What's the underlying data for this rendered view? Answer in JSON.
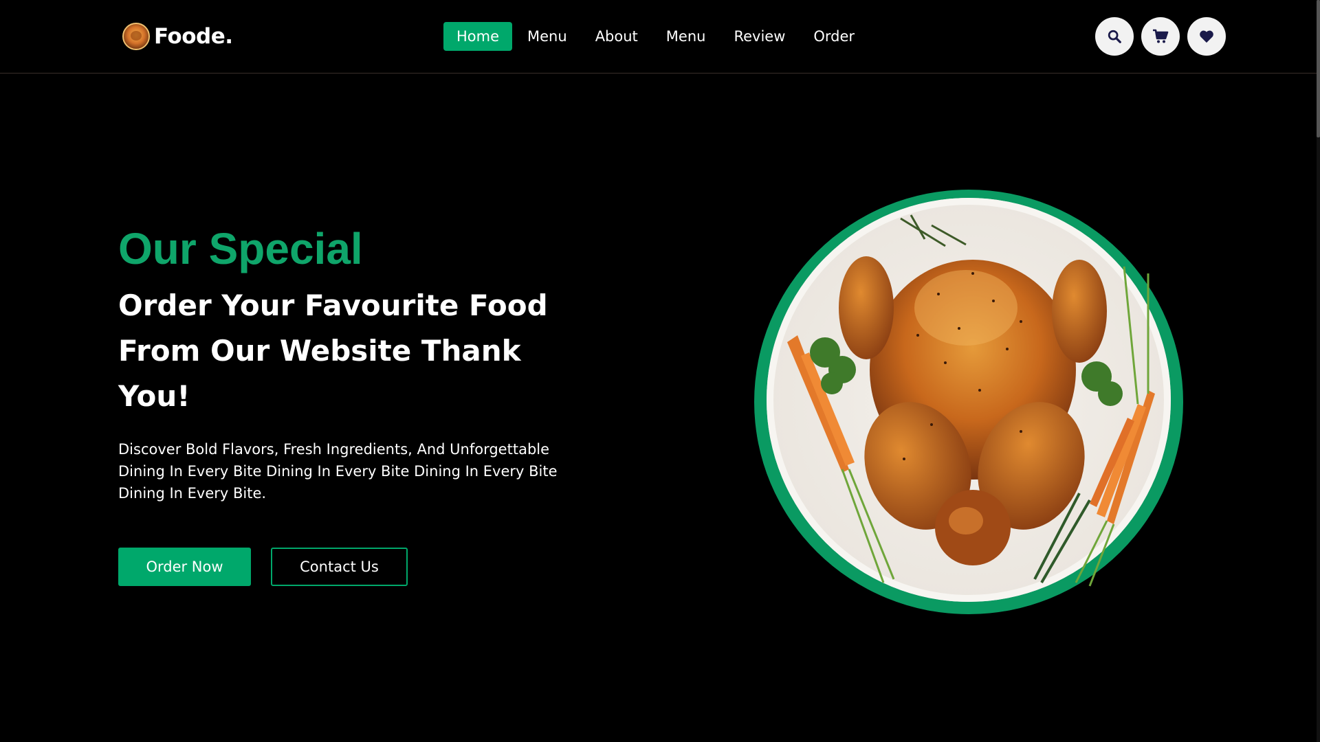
{
  "header": {
    "logo_text": "Foode.",
    "nav": [
      {
        "label": "Home",
        "active": true
      },
      {
        "label": "Menu",
        "active": false
      },
      {
        "label": "About",
        "active": false
      },
      {
        "label": "Menu",
        "active": false
      },
      {
        "label": "Review",
        "active": false
      },
      {
        "label": "Order",
        "active": false
      }
    ],
    "icons": [
      "search-icon",
      "cart-icon",
      "heart-icon"
    ]
  },
  "hero": {
    "title": "Our Special",
    "subtitle": "Order Your Favourite Food From Our Website Thank You!",
    "description": "Discover Bold Flavors, Fresh Ingredients, And Unforgettable Dining In Every Bite Dining In Every Bite Dining In Every Bite Dining In Every Bite.",
    "order_button": "Order Now",
    "contact_button": "Contact Us"
  },
  "colors": {
    "accent": "#00a86b",
    "background": "#000000",
    "text": "#ffffff"
  }
}
